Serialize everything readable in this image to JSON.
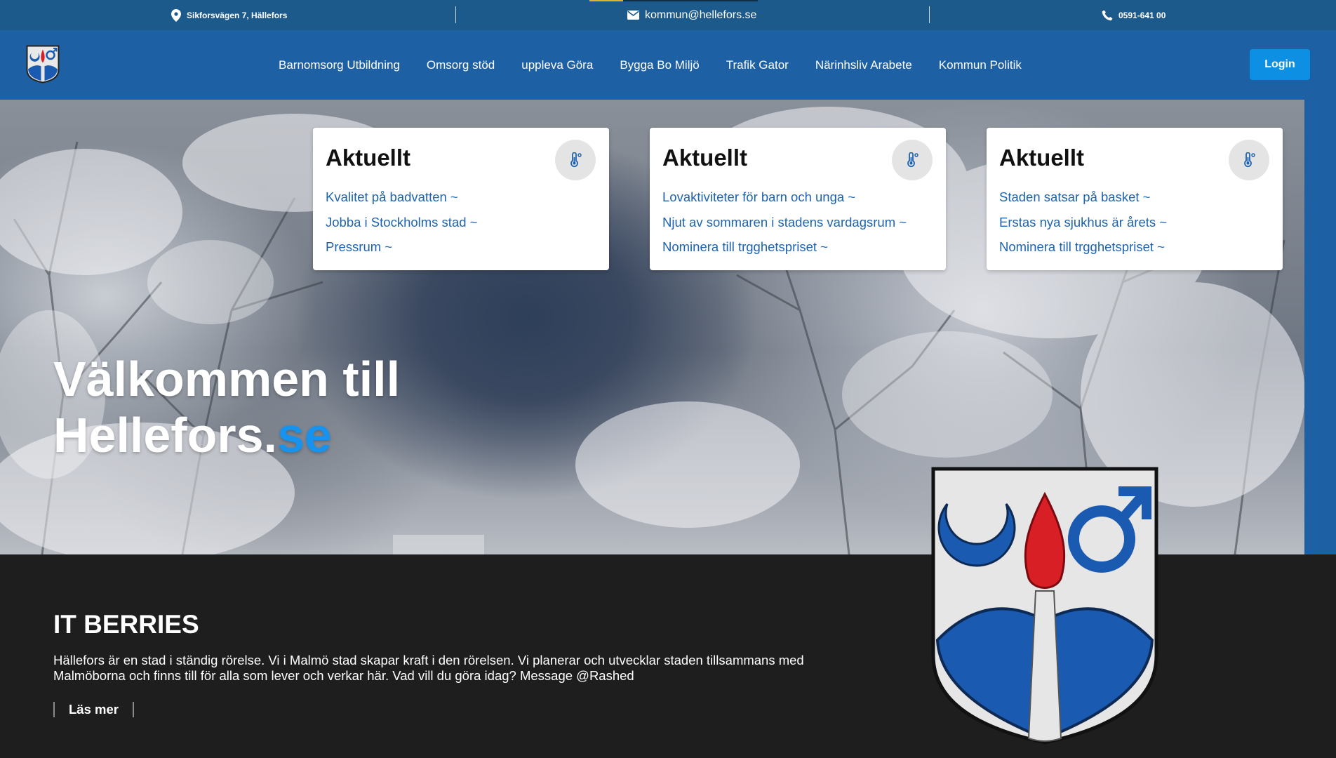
{
  "topbar": {
    "address": "Sikforsvägen 7, Hällefors",
    "email": "kommun@hellefors.se",
    "phone": "0591-641 00"
  },
  "nav": {
    "items": [
      {
        "label": "Barnomsorg Utbildning"
      },
      {
        "label": "Omsorg stöd"
      },
      {
        "label": "uppleva Göra"
      },
      {
        "label": "Bygga Bo Miljö"
      },
      {
        "label": "Trafik Gator"
      },
      {
        "label": "Närinhsliv Arabete"
      },
      {
        "label": "Kommun Politik"
      }
    ],
    "login_label": "Login"
  },
  "cards": [
    {
      "title": "Aktuellt",
      "links": [
        "Kvalitet på badvatten ~",
        "Jobba i Stockholms stad ~",
        "Pressrum ~"
      ]
    },
    {
      "title": "Aktuellt",
      "links": [
        "Lovaktiviteter för barn och unga ~",
        "Njut av sommaren i stadens vardagsrum ~",
        "Nominera till trgghetspriset ~"
      ]
    },
    {
      "title": "Aktuellt",
      "links": [
        "Staden satsar på basket ~",
        "Erstas nya sjukhus är årets ~",
        "Nominera till trgghetspriset ~"
      ]
    }
  ],
  "hero": {
    "line1": "Välkommen till",
    "line2_main": "Hellefors.",
    "line2_accent": "se"
  },
  "section": {
    "title": "IT BERRIES",
    "text": "Hällefors är en stad i ständig rörelse. Vi i Malmö stad skapar kraft i den rörelsen. Vi planerar och utvecklar staden tillsammans med Malmöborna och finns till för alla som lever och verkar här. Vad vill du göra idag? Message @Rashed",
    "read_more": "Läs mer"
  },
  "icons": {
    "address": "location-pin-icon",
    "email": "envelope-icon",
    "phone": "phone-icon",
    "card": "thermometer-icon"
  },
  "colors": {
    "topbar": "#1c5a8c",
    "navbar": "#1d60a3",
    "login": "#0d8fe3",
    "accent": "#1593ef",
    "link": "#1d63b0",
    "dark": "#1e1e1e"
  }
}
